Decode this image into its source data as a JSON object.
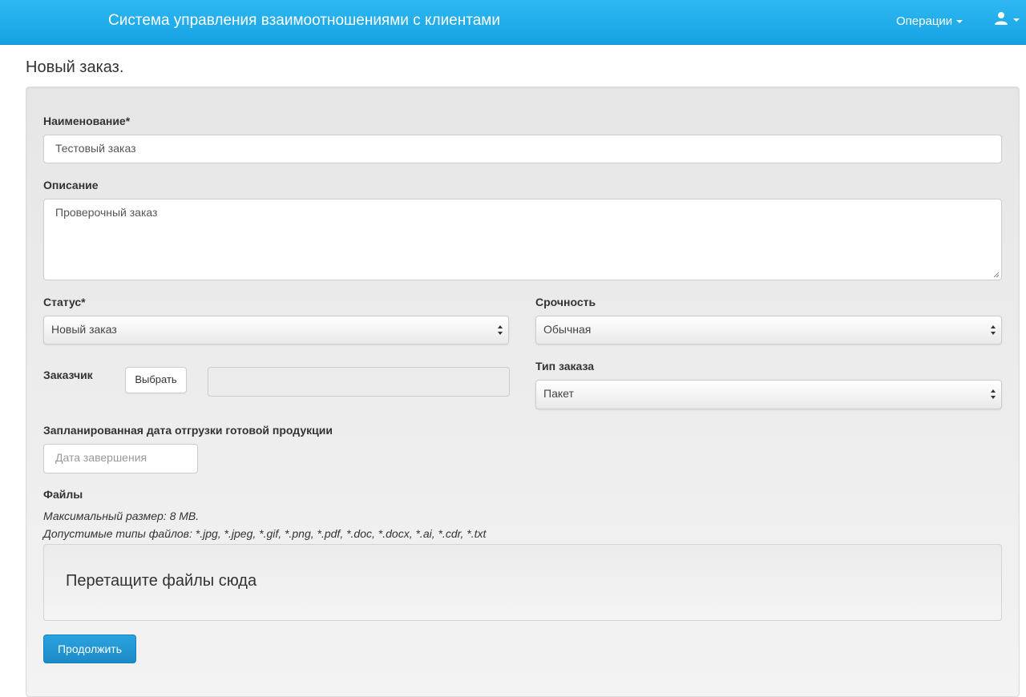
{
  "navbar": {
    "brand": "Система управления взаимоотношениями с клиентами",
    "operations_label": "Операции",
    "user_icon": "user-icon",
    "bg_color": "#1aa8e8"
  },
  "page": {
    "title": "Новый заказ."
  },
  "form": {
    "name": {
      "label": "Наименование*",
      "value": "Тестовый заказ"
    },
    "description": {
      "label": "Описание",
      "value": "Проверочный заказ"
    },
    "status": {
      "label": "Статус*",
      "selected": "Новый заказ"
    },
    "urgency": {
      "label": "Срочность",
      "selected": "Обычная"
    },
    "customer": {
      "label": "Заказчик",
      "choose_label": "Выбрать",
      "value": ""
    },
    "order_type": {
      "label": "Тип заказа",
      "selected": "Пакет"
    },
    "ship_date": {
      "label": "Запланированная дата отгрузки готовой продукции",
      "placeholder": "Дата завершения"
    },
    "files": {
      "label": "Файлы",
      "max_size": "Максимальный размер: 8 MB.",
      "allowed_types": "Допустимые типы файлов: *.jpg, *.jpeg, *.gif, *.png, *.pdf, *.doc, *.docx, *.ai, *.cdr, *.txt",
      "dropzone_text": "Перетащите файлы сюда"
    },
    "submit_label": "Продолжить"
  }
}
